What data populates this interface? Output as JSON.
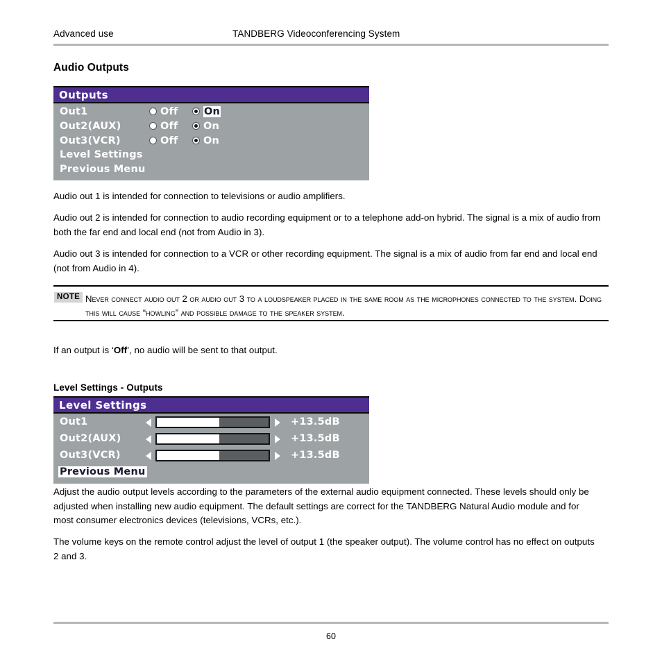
{
  "header": {
    "left": "Advanced use",
    "center": "TANDBERG Videoconferencing System"
  },
  "headings": {
    "audio_outputs": "Audio Outputs",
    "level_settings_outputs": "Level Settings - Outputs"
  },
  "outputs_menu": {
    "title": "Outputs",
    "rows": [
      {
        "label": "Out1",
        "off_label": "Off",
        "on_label": "On",
        "selected": "On",
        "highlighted": true
      },
      {
        "label": "Out2(AUX)",
        "off_label": "Off",
        "on_label": "On",
        "selected": "On",
        "highlighted": false
      },
      {
        "label": "Out3(VCR)",
        "off_label": "Off",
        "on_label": "On",
        "selected": "On",
        "highlighted": false
      }
    ],
    "menu_items": [
      {
        "label": "Level Settings",
        "highlighted": false
      },
      {
        "label": "Previous Menu",
        "highlighted": false
      }
    ]
  },
  "level_settings_menu": {
    "title": "Level Settings",
    "rows": [
      {
        "label": "Out1",
        "value": "+13.5dB",
        "fill_percent": 56
      },
      {
        "label": "Out2(AUX)",
        "value": "+13.5dB",
        "fill_percent": 56
      },
      {
        "label": "Out3(VCR)",
        "value": "+13.5dB",
        "fill_percent": 56
      }
    ],
    "menu_items": [
      {
        "label": "Previous Menu",
        "highlighted": true
      }
    ]
  },
  "paragraphs": {
    "p1": "Audio out 1 is intended for connection to televisions or audio amplifiers.",
    "p2": "Audio out 2 is intended for connection to audio recording equipment or to a telephone add-on hybrid. The signal is a mix of audio from both the far end and local end (not from Audio in 3).",
    "p3": "Audio out 3 is intended for connection to a VCR or other recording equipment. The signal is a mix of audio from far end and local end (not from Audio in 4).",
    "p4": "Adjust the audio output levels according to the parameters of the external audio equipment connected. These levels should only be adjusted when installing new audio equipment. The default settings are correct for the TANDBERG Natural Audio module and for most consumer electronics devices (televisions, VCRs, etc.).",
    "p5": "The volume keys on the remote control adjust the level of output 1 (the speaker output). The volume control has no effect on outputs 2 and 3."
  },
  "off_sentence": {
    "prefix": "If an output is ‘",
    "bold": "Off",
    "suffix": "’, no audio will be sent to that output."
  },
  "note": {
    "label": "NOTE",
    "text": "Never connect audio out 2 or audio out 3 to a loudspeaker placed in the same room as the microphones connected to the system. Doing this will cause “howling” and possible damage to the speaker system."
  },
  "footer": {
    "page_number": "60"
  },
  "colors": {
    "osd_title_bg": "#4e2f91",
    "osd_body_bg": "#9da2a4",
    "rule": "#b7b7b7",
    "note_label_bg": "#d4d4d4"
  }
}
